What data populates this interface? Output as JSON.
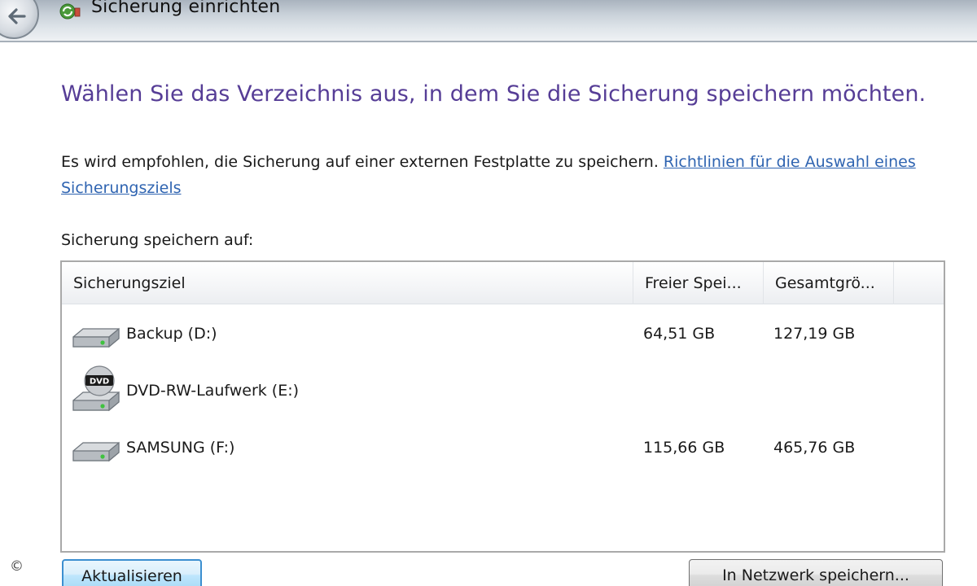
{
  "window": {
    "title": "Sicherung einrichten"
  },
  "main": {
    "heading": "Wählen Sie das Verzeichnis aus, in dem Sie die Sicherung speichern möchten.",
    "intro_text": "Es wird empfohlen, die Sicherung auf einer externen Festplatte zu speichern. ",
    "guidelines_link": "Richtlinien für die Auswahl eines Sicherungsziels",
    "save_to_label": "Sicherung speichern auf:"
  },
  "listview": {
    "columns": [
      "Sicherungsziel",
      "Freier Spei...",
      "Gesamtgrö..."
    ],
    "rows": [
      {
        "name": "Backup (D:)",
        "free": "64,51 GB",
        "total": "127,19 GB",
        "icon": "hard-drive-icon"
      },
      {
        "name": "DVD-RW-Laufwerk (E:)",
        "free": "",
        "total": "",
        "icon": "dvd-drive-icon"
      },
      {
        "name": "SAMSUNG (F:)",
        "free": "115,66 GB",
        "total": "465,76 GB",
        "icon": "hard-drive-icon"
      }
    ]
  },
  "buttons": {
    "refresh_label": "Aktualisieren",
    "network_label": "In Netzwerk speichern..."
  },
  "footer": {
    "copyright_symbol": "©"
  },
  "colors": {
    "heading": "#563d96",
    "link": "#2f64b1",
    "focus_border": "#3c8fd0"
  }
}
